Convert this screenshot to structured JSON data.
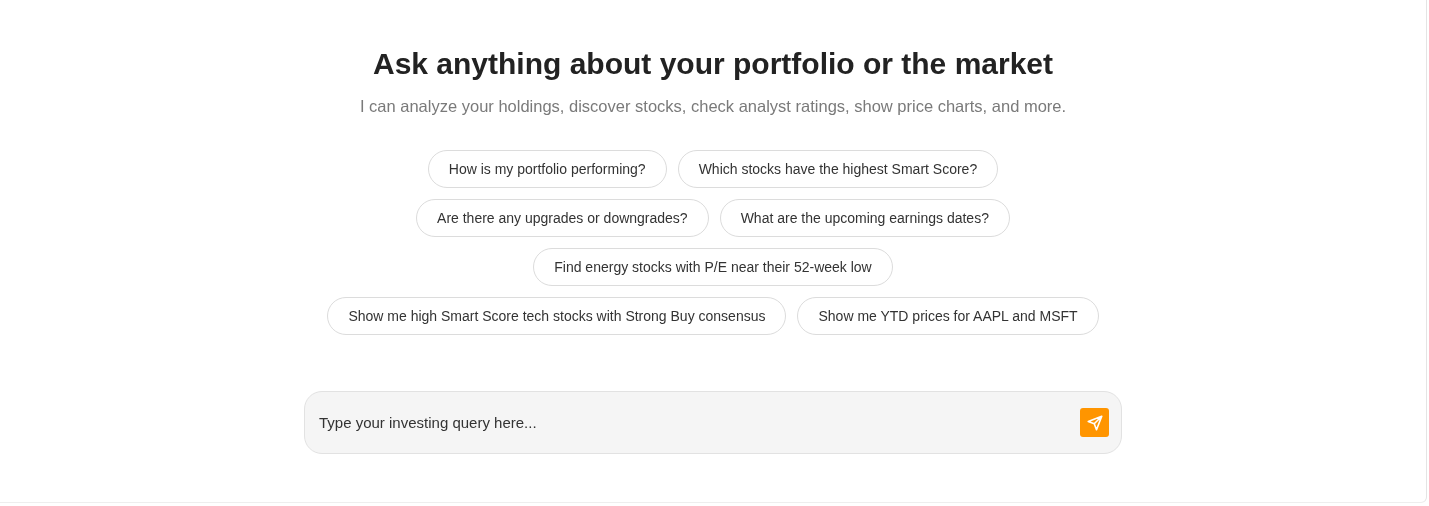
{
  "heading": "Ask anything about your portfolio or the market",
  "subtitle": "I can analyze your holdings, discover stocks, check analyst ratings, show price charts, and more.",
  "suggestion_rows": [
    [
      "How is my portfolio performing?",
      "Which stocks have the highest Smart Score?"
    ],
    [
      "Are there any upgrades or downgrades?",
      "What are the upcoming earnings dates?"
    ],
    [
      "Find energy stocks with P/E near their 52-week low"
    ],
    [
      "Show me high Smart Score tech stocks with Strong Buy consensus",
      "Show me YTD prices for AAPL and MSFT"
    ]
  ],
  "query_field": {
    "placeholder": "Type your investing query here..."
  }
}
